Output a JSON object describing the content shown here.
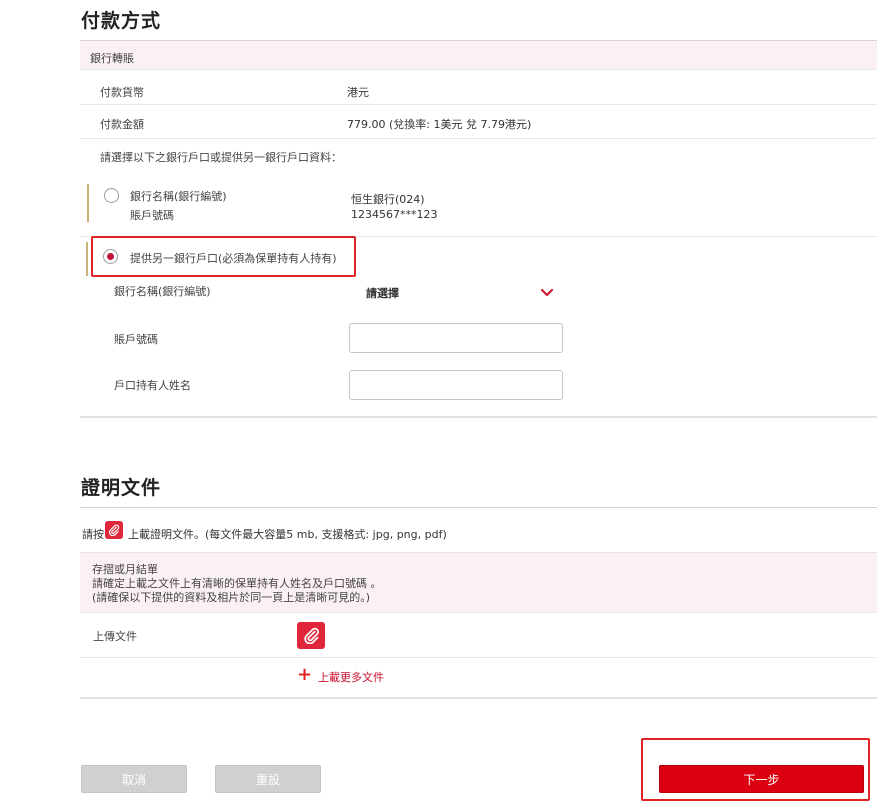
{
  "payment": {
    "title": "付款方式",
    "method_header": "銀行轉賬",
    "currency_label": "付款貨幣",
    "currency_value": "港元",
    "amount_label": "付款金額",
    "amount_value": "779.00 (兌換率: 1美元 兌 7.79港元)",
    "choose_prompt": "請選擇以下之銀行戶口或提供另一銀行戶口資料：",
    "option1": {
      "bank_label": "銀行名稱(銀行編號)",
      "account_label": "賬戶號碼",
      "bank_value": "恒生銀行(024)",
      "account_value": "1234567***123",
      "selected": false
    },
    "option2": {
      "label": "提供另一銀行戶口(必須為保單持有人持有)",
      "selected": true
    },
    "bank_name_label": "銀行名稱(銀行編號)",
    "bank_select_value": "請選擇",
    "account_no_label": "賬戶號碼",
    "account_no_value": "",
    "holder_name_label": "戶口持有人姓名",
    "holder_name_value": ""
  },
  "documents": {
    "title": "證明文件",
    "instruction_prefix": "請按",
    "instruction_suffix": "上載證明文件。(每文件最大容量5 mb, 支援格式: jpg, png, pdf)",
    "box_title": "存摺或月結單",
    "box_line1": "請確定上載之文件上有清晰的保單持有人姓名及戶口號碼 。",
    "box_line2": "(請確保以下提供的資料及相片於同一頁上是清晰可見的。)",
    "upload_label": "上傳文件",
    "upload_more": "上載更多文件"
  },
  "actions": {
    "cancel": "取消",
    "reset": "重設",
    "next": "下一步"
  },
  "colors": {
    "brand_red": "#db0011",
    "highlight_outline": "#e02424",
    "panel_pink": "#fbf1f3"
  },
  "icons": {
    "upload": "paperclip-icon",
    "dropdown": "chevron-down-icon",
    "add": "plus-icon"
  }
}
